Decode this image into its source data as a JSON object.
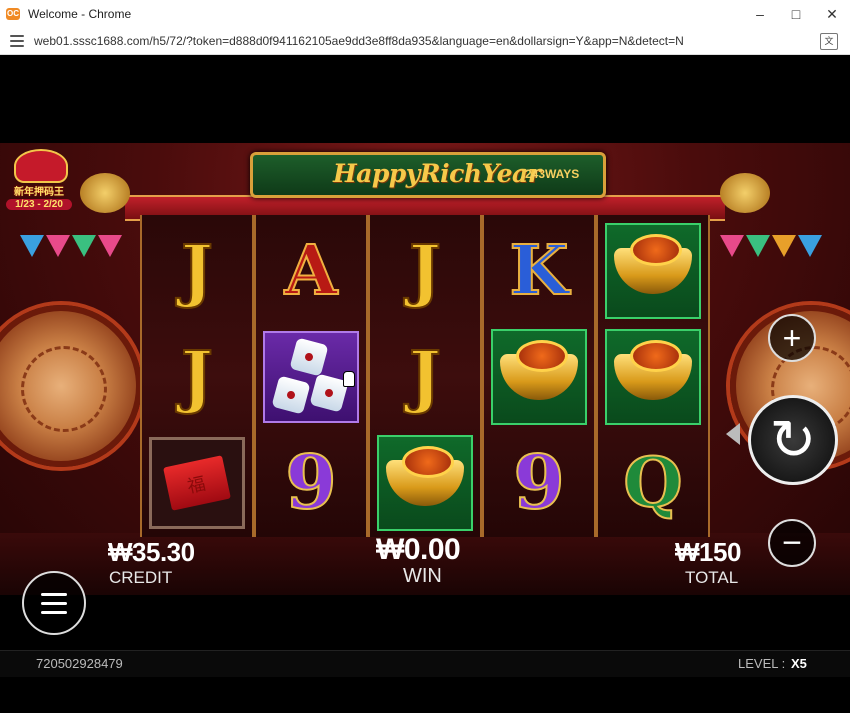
{
  "window": {
    "title": "Welcome - Chrome",
    "logo": "OC",
    "minimize": "–",
    "maximize": "□",
    "close": "✕"
  },
  "address_bar": {
    "url": "web01.sssc1688.com/h5/72/?token=d888d0f941162105ae9dd3e8ff8da935&language=en&dollarsign=Y&app=N&detect=N",
    "translate_glyph": "文"
  },
  "game": {
    "title": "HappyRichYear",
    "ways": "243WAYS",
    "promo": {
      "text": "新年押码王",
      "dates": "1/23 - 2/20"
    },
    "reels": [
      [
        "J",
        "J",
        "envelope"
      ],
      [
        "A",
        "dice",
        "9"
      ],
      [
        "J",
        "J",
        "ingot"
      ],
      [
        "K",
        "ingot",
        "9"
      ],
      [
        "ingot",
        "ingot",
        "Q"
      ]
    ],
    "symbol_glyphs": {
      "J": "J",
      "A": "A",
      "K": "K",
      "Q": "Q",
      "9": "9"
    },
    "credit": {
      "value": "₩35.30",
      "label": "CREDIT"
    },
    "win": {
      "value": "₩0.00",
      "label": "WIN"
    },
    "total": {
      "value": "₩150",
      "label": "TOTAL"
    },
    "buttons": {
      "plus": "+",
      "minus": "−",
      "spin": "↻"
    },
    "footer": {
      "round_id": "720502928479",
      "level_label": "LEVEL :",
      "level_value": "X5"
    }
  },
  "colors": {
    "accent_gold": "#f6c94a",
    "banner_green": "#1d5e2a",
    "stage_red": "#7a1818"
  }
}
